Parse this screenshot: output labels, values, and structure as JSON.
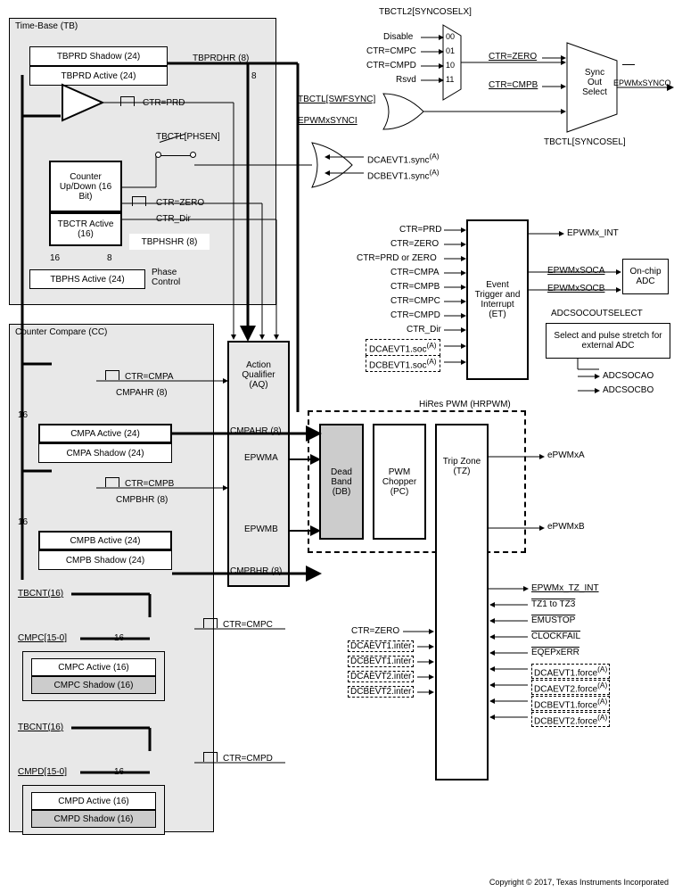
{
  "tb": {
    "title": "Time-Base (TB)",
    "tbprd_shadow": "TBPRD Shadow (24)",
    "tbprd_active": "TBPRD Active (24)",
    "tbprdhr": "TBPRDHR (8)",
    "ctr_prd": "CTR=PRD",
    "phsen": "TBCTL[PHSEN]",
    "counter": "Counter Up/Down (16 Bit)",
    "tbctr": "TBCTR Active (16)",
    "ctr_zero": "CTR=ZERO",
    "ctr_dir": "CTR_Dir",
    "tbphshr": "TBPHSHR (8)",
    "tbphs": "TBPHS Active (24)",
    "phase_ctrl": "Phase Control",
    "bus16": "16",
    "bus8a": "8",
    "bus8b": "8"
  },
  "cc": {
    "title": "Counter Compare (CC)",
    "ctr_cmpa": "CTR=CMPA",
    "cmpahr": "CMPAHR (8)",
    "cmpa_active": "CMPA Active (24)",
    "cmpa_shadow": "CMPA Shadow (24)",
    "ctr_cmpb": "CTR=CMPB",
    "cmpbhr": "CMPBHR (8)",
    "cmpb_active": "CMPB Active (24)",
    "cmpb_shadow": "CMPB Shadow (24)",
    "tbcnt1": "TBCNT(16)",
    "ctr_cmpc": "CTR=CMPC",
    "cmpc_range": "CMPC[15-0]",
    "cmpc_active": "CMPC Active (16)",
    "cmpc_shadow": "CMPC Shadow (16)",
    "tbcnt2": "TBCNT(16)",
    "ctr_cmpd": "CTR=CMPD",
    "cmpd_range": "CMPD[15-0]",
    "cmpd_active": "CMPD Active (16)",
    "cmpd_shadow": "CMPD Shadow (16)",
    "bus16": "16"
  },
  "aq": {
    "title": "Action Qualifier (AQ)",
    "cmpahr": "CMPAHR (8)",
    "epwma": "EPWMA",
    "epwmb": "EPWMB",
    "cmpbhr": "CMPBHR (8)"
  },
  "hrpwm": {
    "title": "HiRes PWM (HRPWM)",
    "db": "Dead Band (DB)",
    "pc": "PWM Chopper (PC)",
    "tz": "Trip Zone (TZ)",
    "epwmxa": "ePWMxA",
    "epwmxb": "ePWMxB"
  },
  "sync": {
    "tbctl2": "TBCTL2[SYNCOSELX]",
    "disable": "Disable",
    "cmpc": "CTR=CMPC",
    "cmpd": "CTR=CMPD",
    "rsvd": "Rsvd",
    "m00": "00",
    "m01": "01",
    "m10": "10",
    "m11": "11",
    "swfsync": "TBCTL[SWFSYNC]",
    "epwmxsynci": "EPWMxSYNCI",
    "ctrzero": "CTR=ZERO",
    "ctrcmpb": "CTR=CMPB",
    "sos": "Sync Out Select",
    "epwmxsynco": "EPWMxSYNCO",
    "syncosel": "TBCTL[SYNCOSEL]",
    "dca": "DCAEVT1.sync",
    "dcb": "DCBEVT1.sync",
    "supA": "(A)"
  },
  "et": {
    "ctr_prd": "CTR=PRD",
    "ctr_zero": "CTR=ZERO",
    "ctr_prd_zero": "CTR=PRD or ZERO",
    "ctr_cmpa": "CTR=CMPA",
    "ctr_cmpb": "CTR=CMPB",
    "ctr_cmpc": "CTR=CMPC",
    "ctr_cmpd": "CTR=CMPD",
    "ctr_dir": "CTR_Dir",
    "dca_soc": "DCAEVT1.soc",
    "dcb_soc": "DCBEVT1.soc",
    "title": "Event Trigger and Interrupt (ET)",
    "epwmx_int": "EPWMx_INT",
    "epwmxsoca": "EPWMxSOCA",
    "epwmxsocb": "EPWMxSOCB",
    "onchip": "On-chip ADC",
    "adcsocout": "ADCSOCOUTSELECT",
    "select_stretch": "Select and pulse stretch for external ADC",
    "adcsocao": "ADCSOCAO",
    "adcsocbo": "ADCSOCBO",
    "supA": "(A)"
  },
  "tz_sigs": {
    "epwm_tz_int": "EPWMx_TZ_INT",
    "tz1_tz3": "TZ1 to TZ3",
    "emustop": "EMUSTOP",
    "clockfail": "CLOCKFAIL",
    "eqepxerr": "EQEPxERR",
    "ctrzero": "CTR=ZERO",
    "dcaevt1i": "DCAEVT1.inter",
    "dcbevt1i": "DCBEVT1.inter",
    "dcaevt2i": "DCAEVT2.inter",
    "dcbevt2i": "DCBEVT2.inter",
    "dcaevt1f": "DCAEVT1.force",
    "dcaevt2f": "DCAEVT2.force",
    "dcbevt1f": "DCBEVT1.force",
    "dcbevt2f": "DCBEVT2.force",
    "supA": "(A)"
  },
  "copyright": "Copyright © 2017, Texas Instruments Incorporated"
}
